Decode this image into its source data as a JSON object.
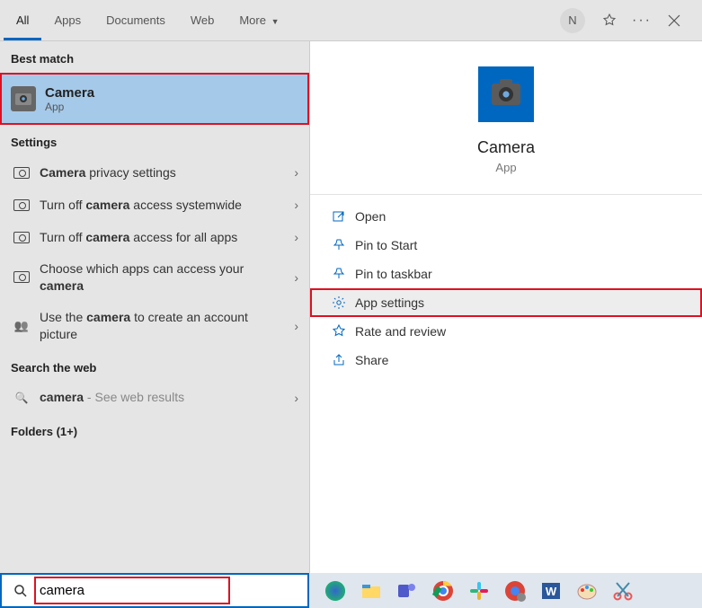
{
  "tabs": [
    "All",
    "Apps",
    "Documents",
    "Web",
    "More"
  ],
  "active_tab": 0,
  "avatar_initial": "N",
  "sections": {
    "best_match": "Best match",
    "settings": "Settings",
    "search_web": "Search the web",
    "folders": "Folders (1+)"
  },
  "best_match": {
    "title": "Camera",
    "subtitle": "App"
  },
  "settings_items": [
    {
      "prefix": "",
      "bold": "Camera",
      "rest": " privacy settings"
    },
    {
      "prefix": "Turn off ",
      "bold": "camera",
      "rest": " access systemwide"
    },
    {
      "prefix": "Turn off ",
      "bold": "camera",
      "rest": " access for all apps"
    },
    {
      "prefix": "Choose which apps can access your ",
      "bold": "camera",
      "rest": ""
    },
    {
      "prefix": "Use the ",
      "bold": "camera",
      "rest": " to create an account picture"
    }
  ],
  "web_item": {
    "bold": "camera",
    "rest": " - See web results"
  },
  "app": {
    "title": "Camera",
    "subtitle": "App"
  },
  "actions": [
    {
      "icon": "open",
      "label": "Open"
    },
    {
      "icon": "pin-start",
      "label": "Pin to Start"
    },
    {
      "icon": "pin-taskbar",
      "label": "Pin to taskbar"
    },
    {
      "icon": "settings",
      "label": "App settings",
      "highlight": true
    },
    {
      "icon": "star",
      "label": "Rate and review"
    },
    {
      "icon": "share",
      "label": "Share"
    }
  ],
  "search_value": "camera",
  "taskbar": [
    "edge",
    "explorer",
    "teams",
    "chrome",
    "slack",
    "chrome2",
    "word",
    "paint",
    "snip"
  ]
}
